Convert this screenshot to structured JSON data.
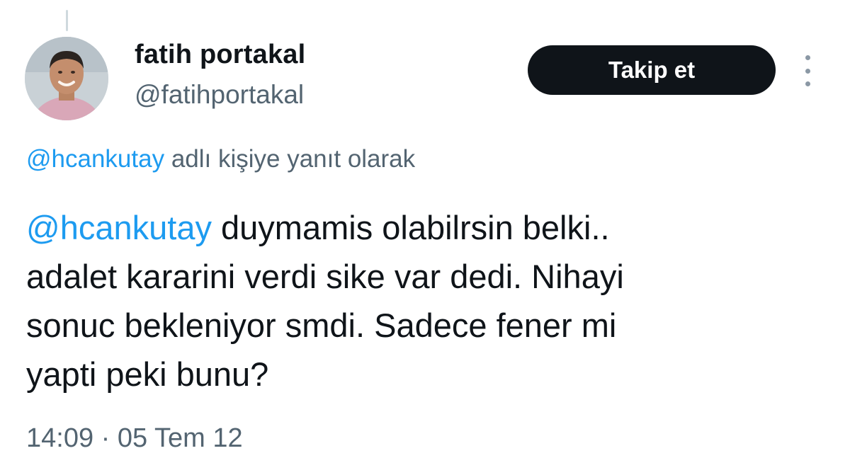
{
  "author": {
    "name": "fatih portakal",
    "handle": "@fatihportakal"
  },
  "follow_button": {
    "label": "Takip et"
  },
  "more_menu": {
    "icon": "more-vertical-icon"
  },
  "reply_context": {
    "mention": "@hcankutay",
    "text": " adlı kişiye yanıt olarak"
  },
  "tweet": {
    "mention": "@hcankutay",
    "lines": [
      " duymamis olabilrsin belki..",
      "adalet kararini verdi sike var dedi. Nihayi",
      "sonuc bekleniyor smdi. Sadece fener mi",
      "yapti peki bunu?"
    ]
  },
  "timestamp": "14:09 · 05 Tem 12",
  "colors": {
    "link": "#1d9bf0",
    "secondary_text": "#536471",
    "button_bg": "#0f1419",
    "thread_line": "#cfd9de"
  }
}
